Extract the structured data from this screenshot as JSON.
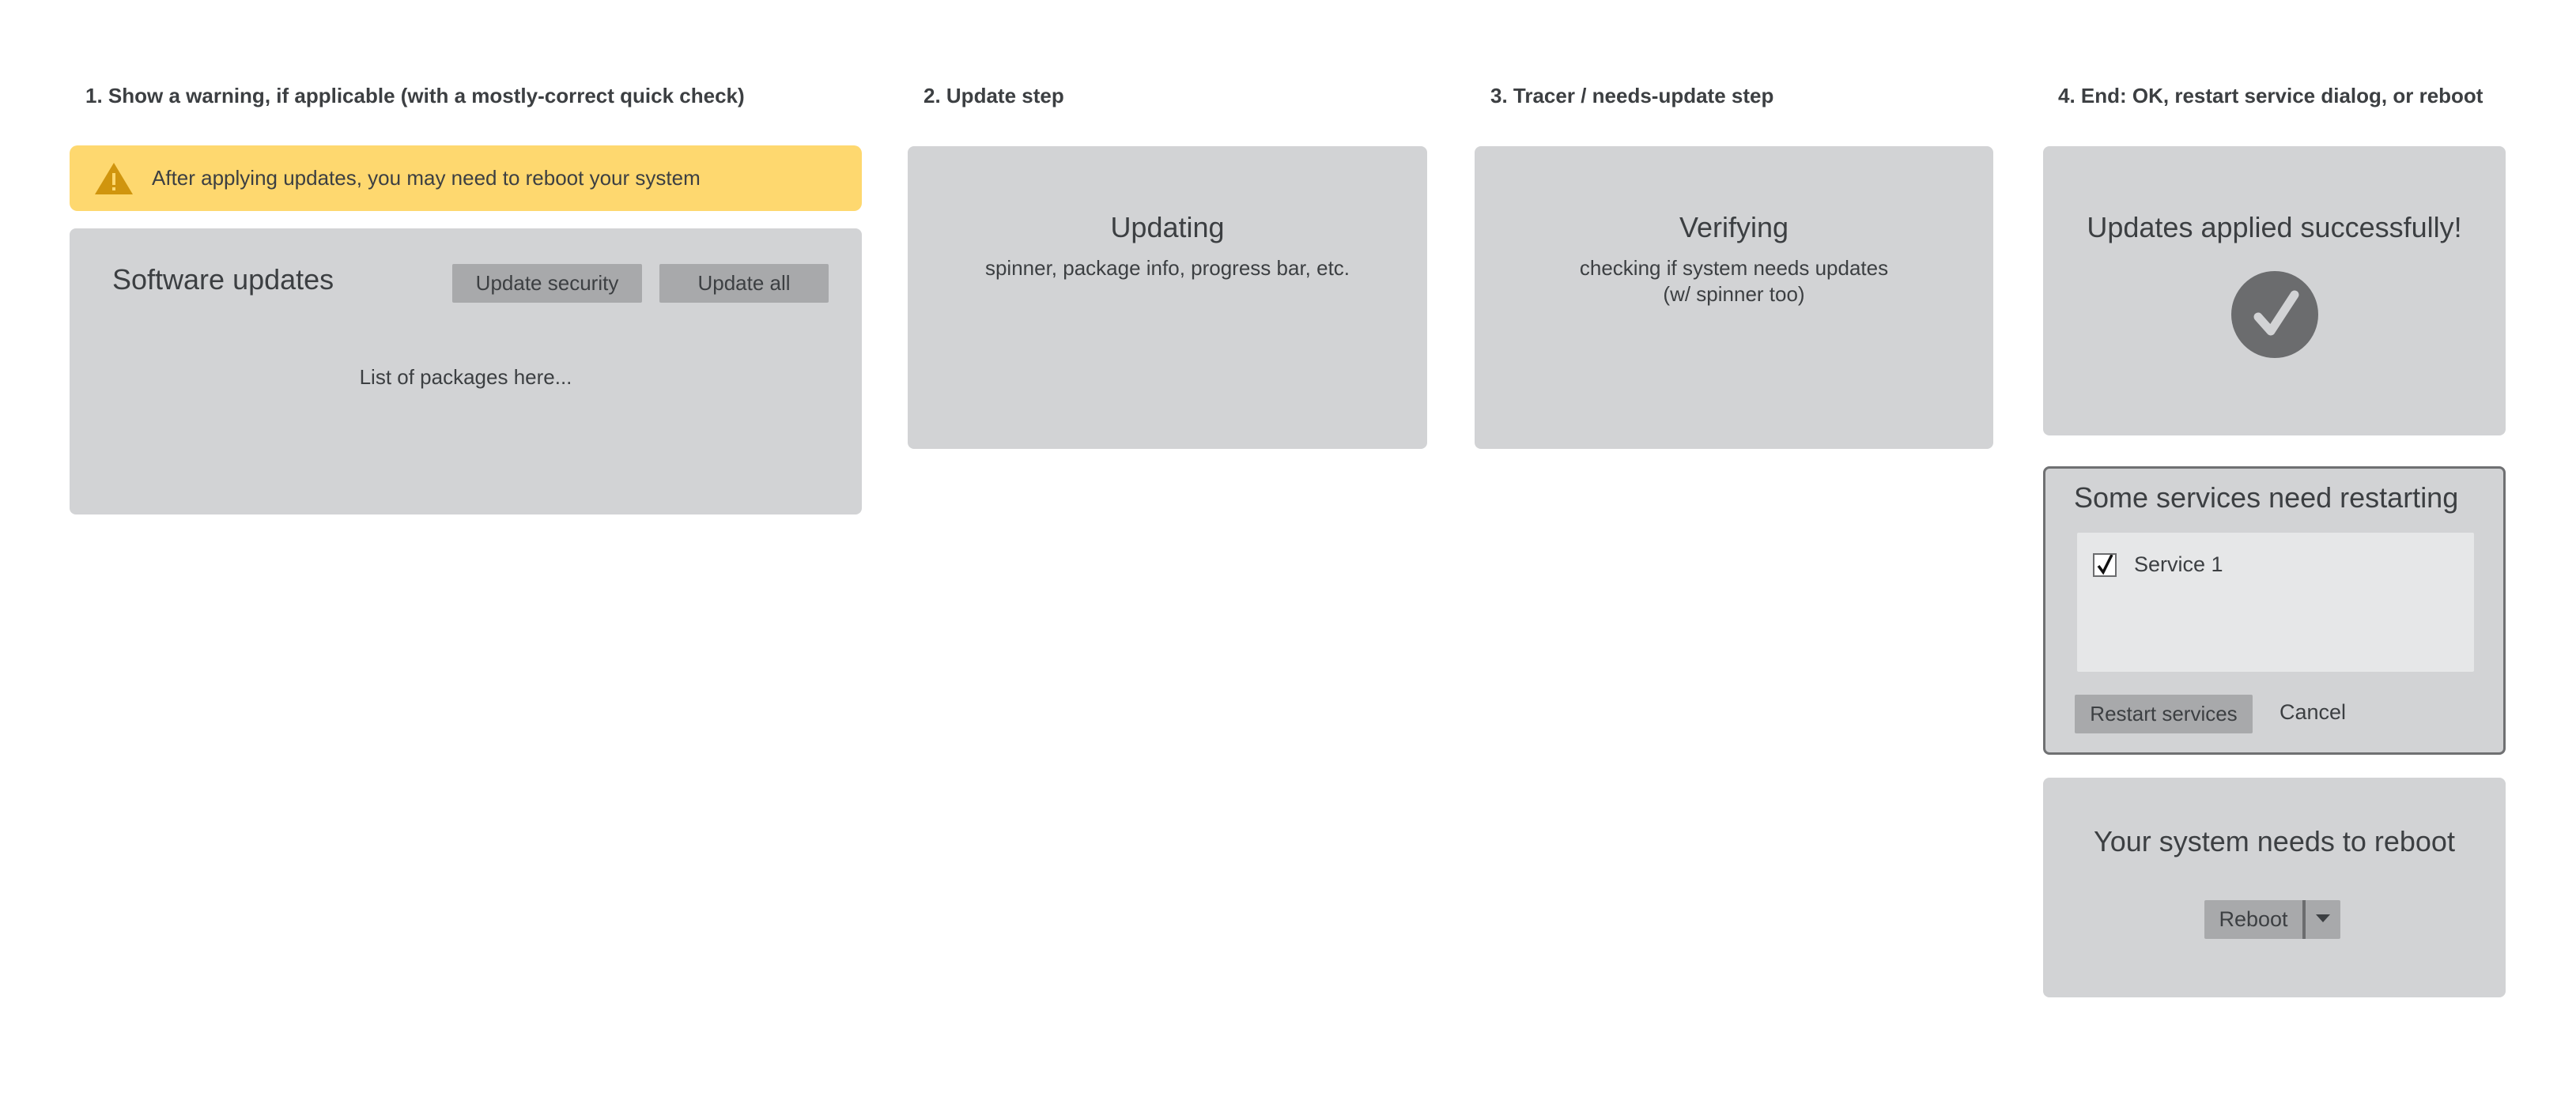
{
  "headings": {
    "step1": "1. Show a warning, if applicable (with a mostly-correct quick check)",
    "step2": "2. Update step",
    "step3": "3. Tracer / needs-update step",
    "step4": "4. End: OK, restart service dialog, or reboot"
  },
  "warning": {
    "icon": "warning-triangle-icon",
    "text": "After applying updates, you may need to reboot your system",
    "color": "#fed86f"
  },
  "software_updates": {
    "title": "Software updates",
    "update_security_label": "Update security",
    "update_all_label": "Update all",
    "list_placeholder": "List of packages here..."
  },
  "updating": {
    "title": "Updating",
    "description": "spinner, package info, progress bar, etc."
  },
  "verifying": {
    "title": "Verifying",
    "description_line1": "checking if system needs updates",
    "description_line2": "(w/ spinner too)"
  },
  "success": {
    "title": "Updates applied successfully!",
    "icon": "check-circle-icon"
  },
  "restart_dialog": {
    "title": "Some services need restarting",
    "services": [
      {
        "label": "Service 1",
        "checked": true
      }
    ],
    "restart_label": "Restart services",
    "cancel_label": "Cancel"
  },
  "reboot": {
    "title": "Your system needs to reboot",
    "button_label": "Reboot",
    "toggle_icon": "caret-down-icon"
  },
  "colors": {
    "panel": "#d2d3d5",
    "button": "#a8a9ab",
    "text": "#3c3f42",
    "warning": "#fed86f"
  }
}
